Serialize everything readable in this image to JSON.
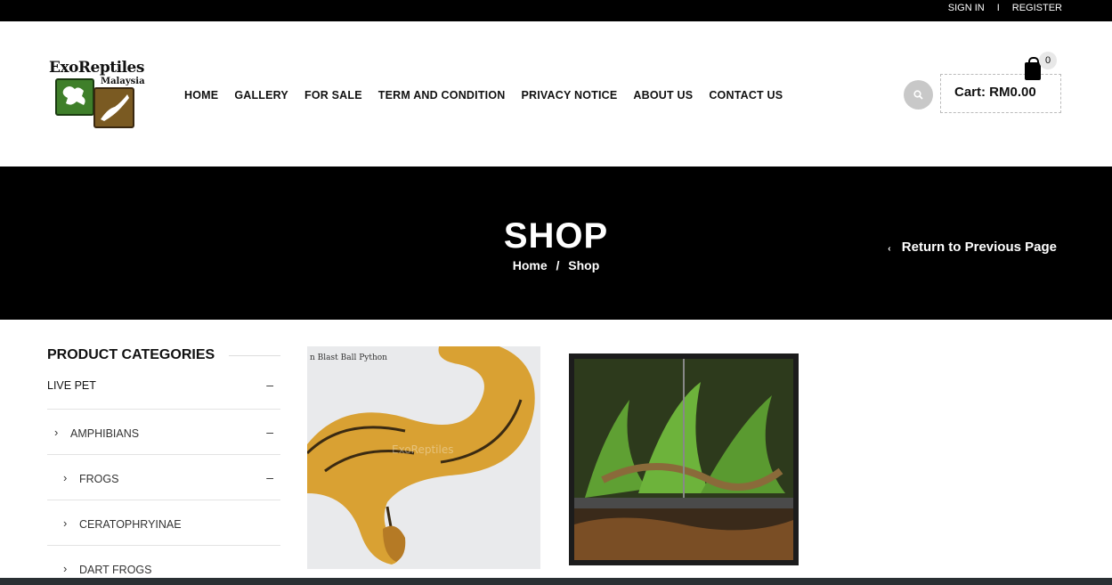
{
  "topbar": {
    "sign_in": "SIGN IN",
    "divider": "I",
    "register": "REGISTER"
  },
  "logo": {
    "text": "ExoReptiles",
    "sub": "Malaysia"
  },
  "nav": [
    "HOME",
    "GALLERY",
    "FOR SALE",
    "TERM AND CONDITION",
    "PRIVACY NOTICE",
    "ABOUT US",
    "CONTACT US"
  ],
  "cart": {
    "label": "Cart: RM0.00",
    "count": "0"
  },
  "icons": {
    "search": "search-icon",
    "cart": "shopping-bag-icon",
    "chevron": "chevron-right-icon",
    "back": "chevron-left-icon"
  },
  "banner": {
    "title": "SHOP",
    "crumb_home": "Home",
    "crumb_sep": "/",
    "crumb_current": "Shop",
    "return": "Return to Previous Page"
  },
  "sidebar": {
    "title": "PRODUCT CATEGORIES",
    "categories": [
      {
        "label": "LIVE PET",
        "toggle": "–"
      },
      {
        "label": "AMPHIBIANS",
        "toggle": "–"
      },
      {
        "label": "FROGS",
        "toggle": "–"
      },
      {
        "label": "CERATOPHRYINAE"
      },
      {
        "label": "DART FROGS"
      }
    ]
  },
  "products": [
    {
      "image_caption": "n Blast Ball Python",
      "watermark": "ExoReptiles"
    },
    {
      "image_caption": ""
    }
  ],
  "colors": {
    "banner_bg": "#000000",
    "topbar_bg": "#000000",
    "search_bg": "#c8c8c8"
  }
}
